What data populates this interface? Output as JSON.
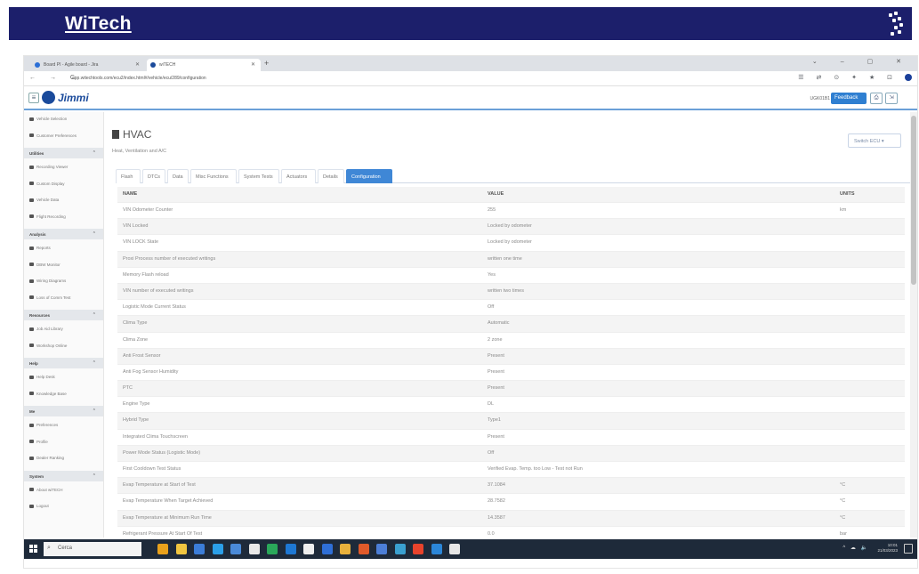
{
  "slide": {
    "title": "WiTech"
  },
  "browser": {
    "tabs": [
      {
        "label": "Board PI - Agile board - Jira",
        "favicon_color": "#2b6fd6"
      },
      {
        "label": "wiTECH",
        "favicon_color": "#1a4a9b"
      }
    ],
    "new_tab": "+",
    "window_controls": "⌄ – ▢ ✕",
    "url": "app.witechtools.com/ecu2/index.html#/vehicle/ecu/289/configuration",
    "extension_icons": "☰ ⇄ ⊙ ✦ ★ ⊡"
  },
  "app": {
    "brand": "Jimmi",
    "menu_icon": "≡",
    "user_id": "UGK01B1",
    "feedback_label": "Feedback",
    "header_icon_1": "⎙",
    "header_icon_2": "⇲"
  },
  "sidebar": {
    "items": [
      {
        "type": "item",
        "label": "Vehicle Selection"
      },
      {
        "type": "item",
        "label": "Customer Preferences"
      },
      {
        "type": "section",
        "label": "Utilities"
      },
      {
        "type": "item",
        "label": "Recording Viewer"
      },
      {
        "type": "item",
        "label": "Custom Display"
      },
      {
        "type": "item",
        "label": "Vehicle Data"
      },
      {
        "type": "item",
        "label": "Flight Recording"
      },
      {
        "type": "section",
        "label": "Analysis"
      },
      {
        "type": "item",
        "label": "Reports"
      },
      {
        "type": "item",
        "label": "DBW Monitor"
      },
      {
        "type": "item",
        "label": "Wiring Diagrams"
      },
      {
        "type": "item",
        "label": "Loss of Comm Test"
      },
      {
        "type": "section",
        "label": "Resources"
      },
      {
        "type": "item",
        "label": "Job Aid Library"
      },
      {
        "type": "item",
        "label": "Workshop Online"
      },
      {
        "type": "section",
        "label": "Help"
      },
      {
        "type": "item",
        "label": "Help Desk"
      },
      {
        "type": "item",
        "label": "Knowledge Base"
      },
      {
        "type": "section",
        "label": "Me"
      },
      {
        "type": "item",
        "label": "Preferences"
      },
      {
        "type": "item",
        "label": "Profile"
      },
      {
        "type": "item",
        "label": "Dealer Ranking"
      },
      {
        "type": "section",
        "label": "System"
      },
      {
        "type": "item",
        "label": "About wiTECH"
      },
      {
        "type": "item",
        "label": "Logout"
      }
    ]
  },
  "module": {
    "title": "HVAC",
    "subtitle": "Heat, Ventilation and A/C",
    "switch_ecu": "Switch ECU ▾"
  },
  "tabs": [
    "Flash",
    "DTCs",
    "Data",
    "Misc Functions",
    "System Tests",
    "Actuators",
    "Details",
    "Configuration"
  ],
  "active_tab": 7,
  "table": {
    "headers": [
      "NAME",
      "VALUE",
      "UNITS"
    ],
    "rows": [
      [
        "VIN Odometer Counter",
        "255",
        "km"
      ],
      [
        "VIN Locked",
        "Locked by odometer",
        ""
      ],
      [
        "VIN LOCK State",
        "Locked by odometer",
        ""
      ],
      [
        "Proxi Process number of executed writings",
        "written one time",
        ""
      ],
      [
        "Memory Flash reload",
        "Yes",
        ""
      ],
      [
        "VIN number of executed writings",
        "written two times",
        ""
      ],
      [
        "Logistic Mode Current Status",
        "Off",
        ""
      ],
      [
        "Clima Type",
        "Automatic",
        ""
      ],
      [
        "Clima Zone",
        "2 zone",
        ""
      ],
      [
        "Anti Frost Sensor",
        "Present",
        ""
      ],
      [
        "Anti Fog Sensor Humidity",
        "Present",
        ""
      ],
      [
        "PTC",
        "Present",
        ""
      ],
      [
        "Engine Type",
        "DL",
        ""
      ],
      [
        "Hybrid Type",
        "Type1",
        ""
      ],
      [
        "Integrated Clima Touchscreen",
        "Present",
        ""
      ],
      [
        "Power Mode Status (Logistic Mode)",
        "Off",
        ""
      ],
      [
        "First Cooldown Test Status",
        "Verified Evap. Temp. too Low - Test not Run",
        ""
      ],
      [
        "Evap Temperature at Start of Test",
        "37.1084",
        "°C"
      ],
      [
        "Evap Temperature When Target Achieved",
        "28.7582",
        "°C"
      ],
      [
        "Evap Temperature at Minimum Run Time",
        "14.3587",
        "°C"
      ],
      [
        "Refrigerant Pressure At Start Of Test",
        "0.0",
        "bar"
      ]
    ]
  },
  "taskbar": {
    "search_placeholder": "Cerca",
    "search_icon": "⌕",
    "tray": "^ ☁ 🔈",
    "time": "10:01",
    "date": "21/03/2023",
    "app_icon_colors": [
      "#e8a11c",
      "#f0c540",
      "#3b7dd8",
      "#2b9fe8",
      "#4a8ad8",
      "#e8e8e8",
      "#2aa85a",
      "#1e78d4",
      "#eeeeee",
      "#2f6fd6",
      "#e8b13c",
      "#e05a2a",
      "#4c7fd8",
      "#3aa0d0",
      "#e8432c",
      "#2b86d8",
      "#e6e6e6"
    ]
  }
}
